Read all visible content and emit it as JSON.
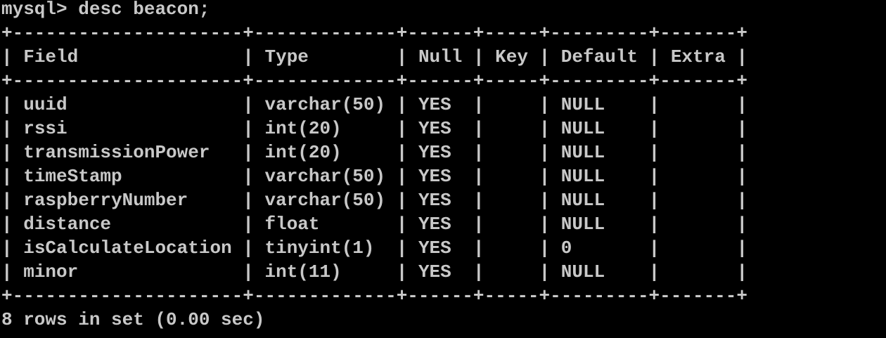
{
  "terminal": {
    "prompt": "mysql>",
    "command": "desc beacon;",
    "separator": "+---------------------+-------------+------+-----+---------+-------+",
    "header": {
      "field": "Field",
      "type": "Type",
      "null": "Null",
      "key": "Key",
      "default": "Default",
      "extra": "Extra"
    },
    "rows": [
      {
        "field": "uuid",
        "type": "varchar(50)",
        "null": "YES",
        "key": "",
        "default": "NULL",
        "extra": ""
      },
      {
        "field": "rssi",
        "type": "int(20)",
        "null": "YES",
        "key": "",
        "default": "NULL",
        "extra": ""
      },
      {
        "field": "transmissionPower",
        "type": "int(20)",
        "null": "YES",
        "key": "",
        "default": "NULL",
        "extra": ""
      },
      {
        "field": "timeStamp",
        "type": "varchar(50)",
        "null": "YES",
        "key": "",
        "default": "NULL",
        "extra": ""
      },
      {
        "field": "raspberryNumber",
        "type": "varchar(50)",
        "null": "YES",
        "key": "",
        "default": "NULL",
        "extra": ""
      },
      {
        "field": "distance",
        "type": "float",
        "null": "YES",
        "key": "",
        "default": "NULL",
        "extra": ""
      },
      {
        "field": "isCalculateLocation",
        "type": "tinyint(1)",
        "null": "YES",
        "key": "",
        "default": "0",
        "extra": ""
      },
      {
        "field": "minor",
        "type": "int(11)",
        "null": "YES",
        "key": "",
        "default": "NULL",
        "extra": ""
      }
    ],
    "footer": "8 rows in set (0.00 sec)"
  }
}
